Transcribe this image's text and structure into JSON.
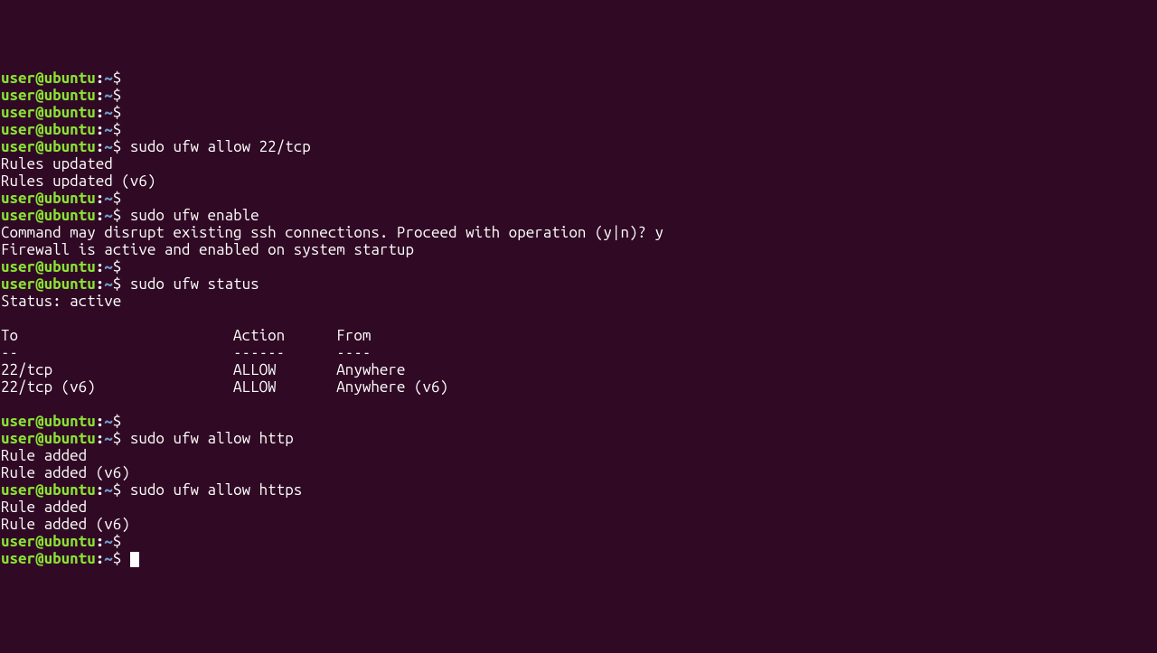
{
  "prompt": {
    "user_host": "user@ubuntu",
    "colon": ":",
    "path": "~",
    "dollar": "$"
  },
  "lines": {
    "l0": "",
    "l1": "",
    "l2": "",
    "l3": "",
    "l4_cmd": "sudo ufw allow 22/tcp",
    "l5": "Rules updated",
    "l6": "Rules updated (v6)",
    "l7": "",
    "l8_cmd": "sudo ufw enable",
    "l9": "Command may disrupt existing ssh connections. Proceed with operation (y|n)? y",
    "l10": "Firewall is active and enabled on system startup",
    "l11": "",
    "l12_cmd": "sudo ufw status",
    "l13": "Status: active",
    "l14": "",
    "l15": "To                         Action      From",
    "l16": "--                         ------      ----",
    "l17": "22/tcp                     ALLOW       Anywhere",
    "l18": "22/tcp (v6)                ALLOW       Anywhere (v6)",
    "l19": "",
    "l20": "",
    "l21_cmd": "sudo ufw allow http",
    "l22": "Rule added",
    "l23": "Rule added (v6)",
    "l24_cmd": "sudo ufw allow https",
    "l25": "Rule added",
    "l26": "Rule added (v6)",
    "l27": "",
    "l28": ""
  }
}
